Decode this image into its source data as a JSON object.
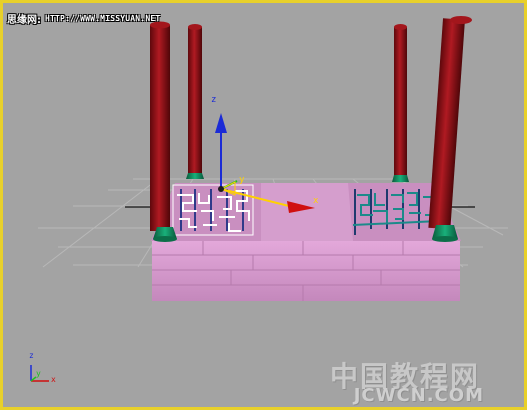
{
  "watermark_top": {
    "site_name": "思缘网:",
    "url": "HTTP://WWW.MISSYUAN.NET"
  },
  "gizmo": {
    "move_axis_x": "x",
    "move_axis_y": "y",
    "move_axis_z": "z"
  },
  "view_axes": {
    "x": "x",
    "y": "y",
    "z": "z"
  },
  "watermark_bottom": {
    "chinese": "中国教程网",
    "latin": "JCWCN.COM"
  },
  "colors": {
    "viewport_background": "#a3a3a3",
    "viewport_border": "#e8d02a",
    "pillar": "#8f1016",
    "pillar_base": "#0f8a5a",
    "platform": "#d59bcc",
    "selection": "#ffffff"
  }
}
